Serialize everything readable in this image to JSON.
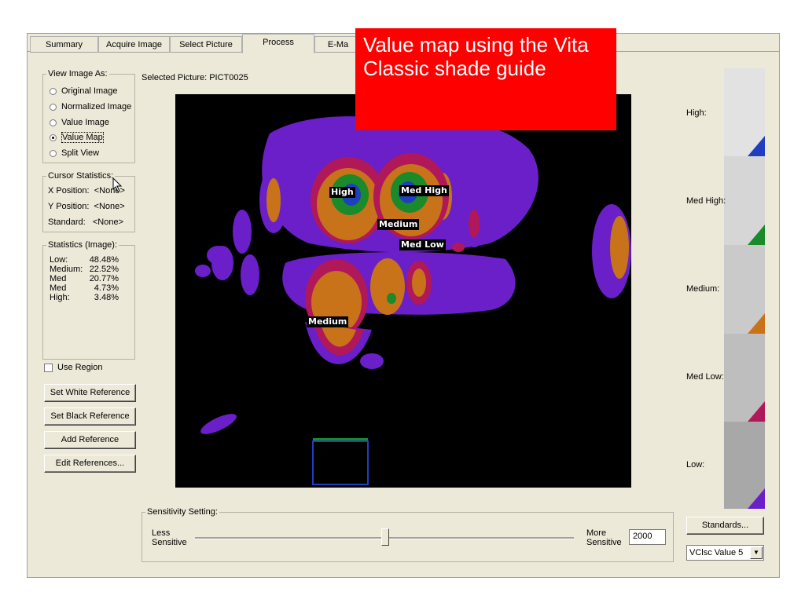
{
  "tabs": [
    {
      "label": "Summary"
    },
    {
      "label": "Acquire Image"
    },
    {
      "label": "Select Picture"
    },
    {
      "label": "Process"
    },
    {
      "label": "E-Ma"
    }
  ],
  "view_image_as": {
    "legend": "View Image As:",
    "options": [
      {
        "label": "Original Image",
        "selected": false
      },
      {
        "label": "Normalized Image",
        "selected": false
      },
      {
        "label": "Value Image",
        "selected": false
      },
      {
        "label": "Value Map",
        "selected": true
      },
      {
        "label": "Split View",
        "selected": false
      }
    ]
  },
  "cursor_statistics": {
    "legend": "Cursor Statistics:",
    "x_label": "X Position:",
    "x_value": "<None>",
    "y_label": "Y Position:",
    "y_value": "<None>",
    "std_label": "Standard:",
    "std_value": "<None>"
  },
  "statistics": {
    "legend": "Statistics (Image):",
    "rows": [
      {
        "label": "Low:",
        "value": "48.48%"
      },
      {
        "label": "Medium:",
        "value": "22.52%"
      },
      {
        "label": "Med",
        "value": "20.77%"
      },
      {
        "label": "Med",
        "value": "4.73%"
      },
      {
        "label": "High:",
        "value": "3.48%"
      }
    ]
  },
  "use_region_label": "Use Region",
  "buttons": {
    "set_white": "Set White Reference",
    "set_black": "Set Black Reference",
    "add_ref": "Add Reference",
    "edit_refs": "Edit References..."
  },
  "selected_picture": "Selected Picture: PICT0025",
  "map_labels": {
    "high": "High",
    "med_high": "Med High",
    "medium_top": "Medium",
    "med_low": "Med Low",
    "medium_bottom": "Medium"
  },
  "overlay_text": "Value map using the Vita Classic shade guide",
  "standards": [
    {
      "label": "High:",
      "tri_color": "#1f3fbf"
    },
    {
      "label": "Med High:",
      "tri_color": "#1a8a2a"
    },
    {
      "label": "Medium:",
      "tri_color": "#c8731a"
    },
    {
      "label": "Med Low:",
      "tri_color": "#b0185a"
    },
    {
      "label": "Low:",
      "tri_color": "#6a1fc8"
    }
  ],
  "sensitivity": {
    "legend": "Sensitivity Setting:",
    "less": "Less\nSensitive",
    "more": "More\nSensitive",
    "value": "2000",
    "level_fraction": 0.5
  },
  "standards_button": "Standards...",
  "standard_select": "VClsc Value 5"
}
